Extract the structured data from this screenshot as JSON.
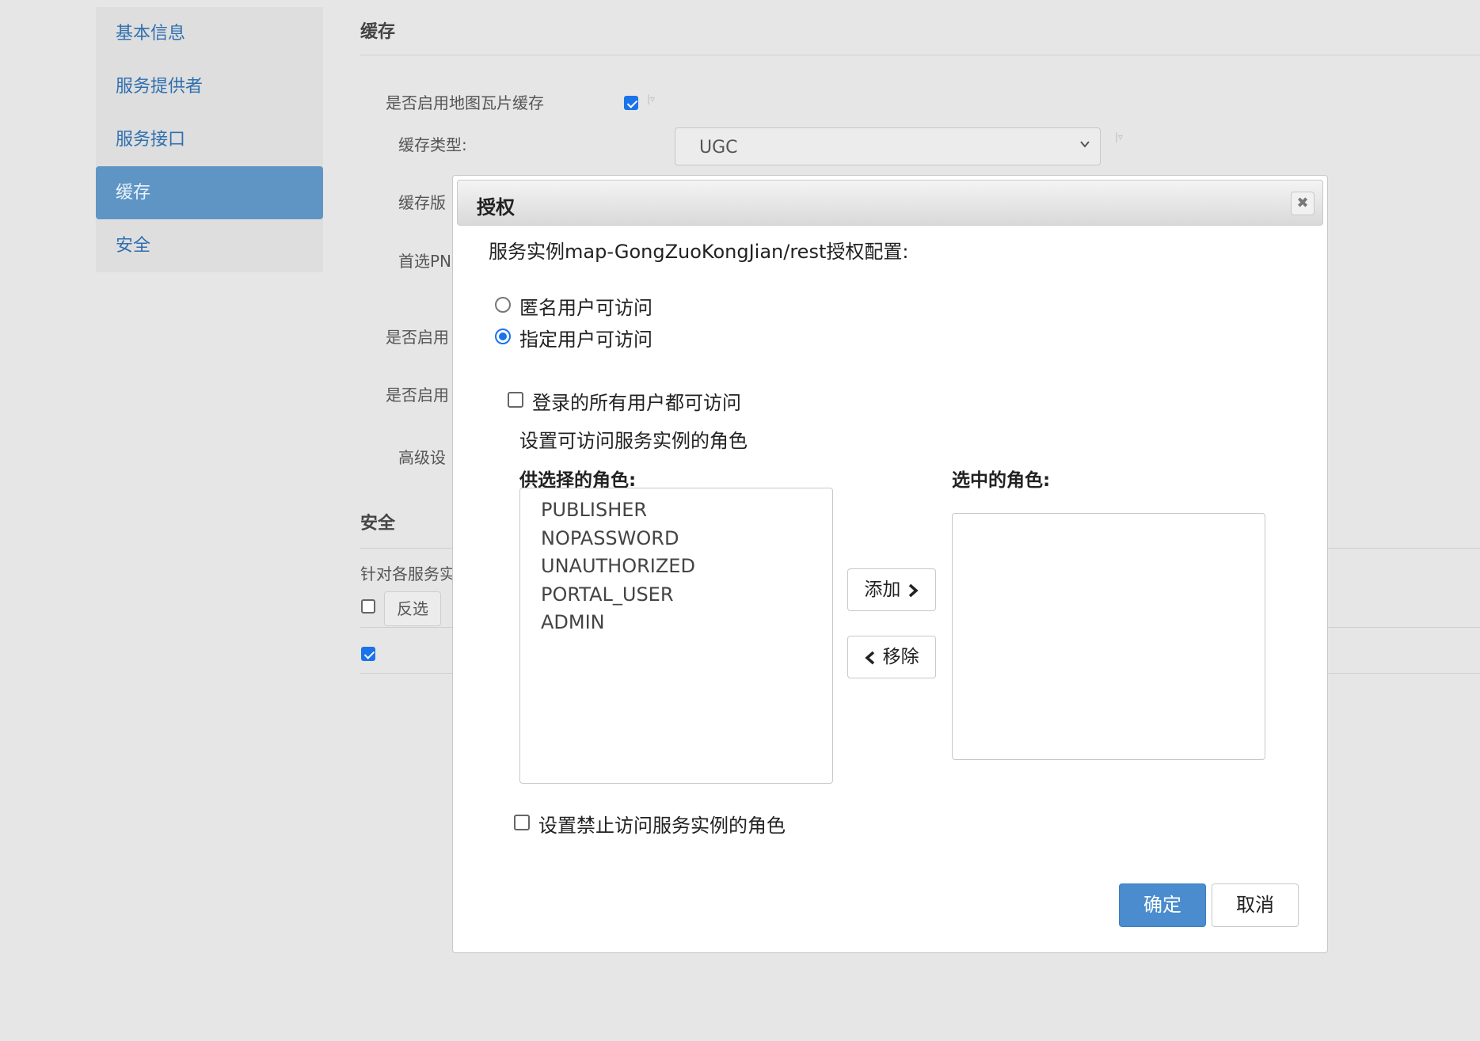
{
  "sidebar": {
    "items": [
      {
        "label": "基本信息"
      },
      {
        "label": "服务提供者"
      },
      {
        "label": "服务接口"
      },
      {
        "label": "缓存"
      },
      {
        "label": "安全"
      }
    ]
  },
  "cache_section": {
    "title": "缓存",
    "enable_tile_cache_label": "是否启用地图瓦片缓存",
    "cache_type_label": "缓存类型:",
    "cache_type_value": "UGC",
    "cache_version_label": "缓存版",
    "preferred_png_label": "首选PN",
    "enable_label_1": "是否启用",
    "enable_label_2": "是否启用",
    "advanced_label": "高级设"
  },
  "security_section": {
    "title": "安全",
    "description": "针对各服务实",
    "invert_button": "反选"
  },
  "dialog": {
    "title": "授权",
    "close_glyph": "✖",
    "heading": "服务实例map-GongZuoKongJian/rest授权配置:",
    "radio_anonymous": "匿名用户可访问",
    "radio_specified": "指定用户可访问",
    "all_logged_in_label": "登录的所有用户都可访问",
    "set_roles_label": "设置可访问服务实例的角色",
    "available_roles_label": "供选择的角色:",
    "selected_roles_label": "选中的角色:",
    "available_roles": [
      "PUBLISHER",
      "NOPASSWORD",
      "UNAUTHORIZED",
      "PORTAL_USER",
      "ADMIN"
    ],
    "selected_roles": [],
    "add_button": "添加",
    "remove_button": "移除",
    "deny_roles_label": "设置禁止访问服务实例的角色",
    "ok_button": "确定",
    "cancel_button": "取消"
  },
  "colors": {
    "accent": "#4a8ccd",
    "sidebar_active": "#5f95c5",
    "link": "#2f6fb0"
  }
}
